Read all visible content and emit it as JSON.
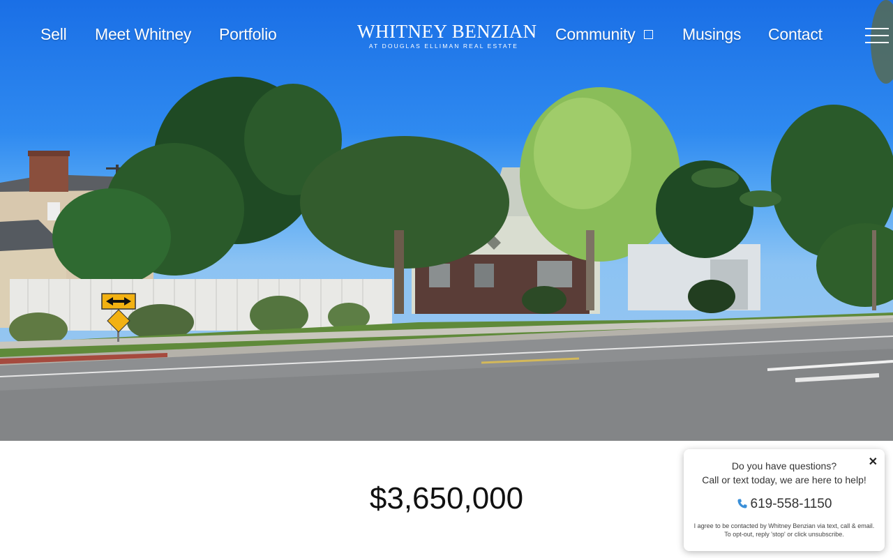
{
  "nav": {
    "left": [
      "Sell",
      "Meet Whitney",
      "Portfolio"
    ],
    "right": [
      "Community",
      "Musings",
      "Contact"
    ]
  },
  "logo": {
    "main": "WHITNEY BENZIAN",
    "sub": "AT DOUGLAS ELLIMAN REAL ESTATE"
  },
  "icons": {
    "community_dropdown": "chevron-down-icon",
    "menu": "hamburger-menu-icon",
    "close": "close-icon",
    "phone": "phone-icon"
  },
  "listing": {
    "price": "$3,650,000"
  },
  "chat": {
    "question": "Do you have questions?",
    "cta": "Call or text today, we are here to help!",
    "phone": "619-558-1150",
    "consent": "I agree to be contacted by Whitney Benzian via text, call & email. To opt-out, reply 'stop' or click unsubscribe.",
    "close": "✕"
  },
  "colors": {
    "sky": "#2f8af0",
    "phone_icon": "#3a8fd8"
  }
}
